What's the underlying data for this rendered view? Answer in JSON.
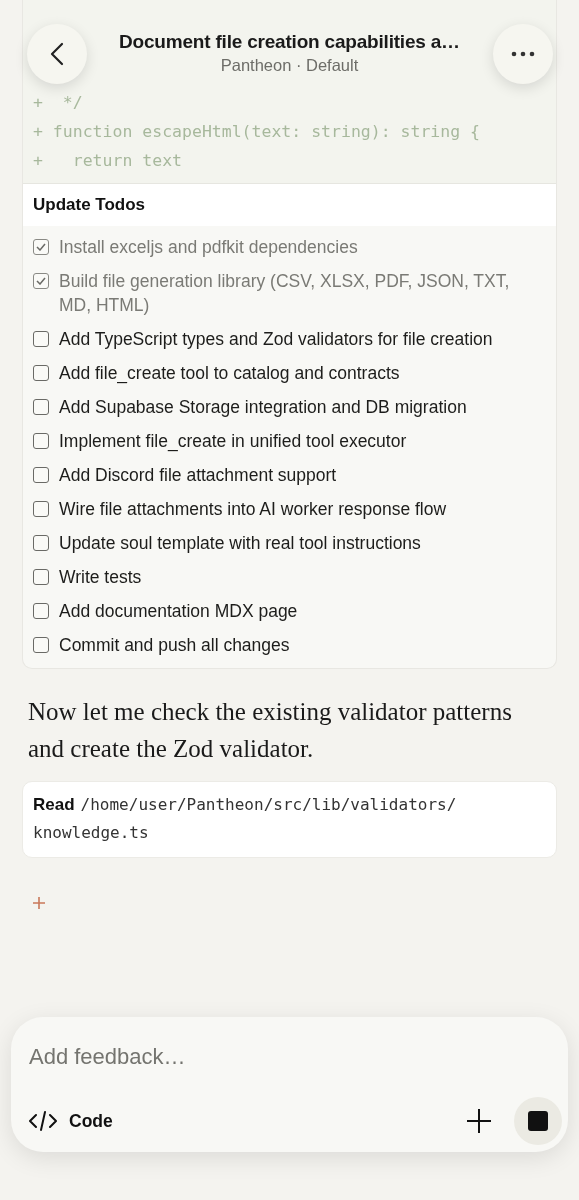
{
  "header": {
    "title": "Document file creation capabilities a…",
    "subtitle": "Pantheon · Default"
  },
  "code_lines": [
    "+  */",
    "+ function escapeHtml(text: string): string {",
    "+   return text"
  ],
  "todos": {
    "title": "Update Todos",
    "items": [
      {
        "label": "Install exceljs and pdfkit dependencies",
        "checked": true
      },
      {
        "label": "Build file generation library (CSV, XLSX, PDF, JSON, TXT, MD, HTML)",
        "checked": true
      },
      {
        "label": "Add TypeScript types and Zod validators for file creation",
        "checked": false
      },
      {
        "label": "Add file_create tool to catalog and contracts",
        "checked": false
      },
      {
        "label": "Add Supabase Storage integration and DB migration",
        "checked": false
      },
      {
        "label": "Implement file_create in unified tool executor",
        "checked": false
      },
      {
        "label": "Add Discord file attachment support",
        "checked": false
      },
      {
        "label": "Wire file attachments into AI worker response flow",
        "checked": false
      },
      {
        "label": "Update soul template with real tool instructions",
        "checked": false
      },
      {
        "label": "Write tests",
        "checked": false
      },
      {
        "label": "Add documentation MDX page",
        "checked": false
      },
      {
        "label": "Commit and push all changes",
        "checked": false
      }
    ]
  },
  "message": "Now let me check the existing validator patterns and create the Zod validator.",
  "tool_call": {
    "action": "Read",
    "path": "/home/user/Pantheon/src/lib/validators/knowledge.ts"
  },
  "composer": {
    "placeholder": "Add feedback…",
    "mode": "Code"
  }
}
